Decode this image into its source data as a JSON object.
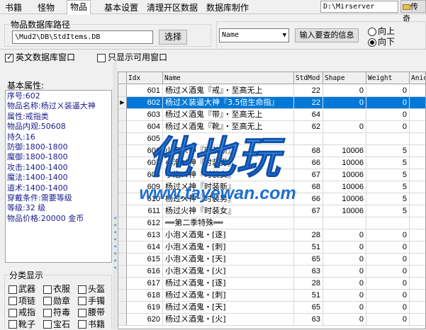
{
  "tabs": [
    "书籍",
    "怪物",
    "物品",
    "基本设置",
    "清理开区数据",
    "数据库制作"
  ],
  "active_tab": "物品",
  "server_path": "D:\\Mirserver",
  "folder_button": "传奇",
  "db_section": {
    "label": "物品数据库路径",
    "path_value": "\\Mud2\\DB\\StdItems.DB",
    "select_button": "选择"
  },
  "search": {
    "field_value": "Name",
    "input_button": "输入要查的信息",
    "dir_up": "向上",
    "dir_down": "向下"
  },
  "options": {
    "english_db_window": "英文数据库窗口",
    "english_db_checked": true,
    "only_usable_window": "只显示可用窗口",
    "only_usable_checked": false
  },
  "basic_info": {
    "label": "基本属性:",
    "lines": [
      "序号:602",
      "物品名称:杨过ㄨ装逼大神",
      "属性:戒指类",
      "物品内观:50608",
      "持久:16",
      "防御:1800-1800",
      "魔御:1800-1800",
      "攻击:1400-1400",
      "魔法:1400-1400",
      "道术:1400-1400",
      "穿戴条件:需要等级",
      "等级:32 级",
      "物品价格:20000 金币"
    ]
  },
  "category": {
    "label": "分类显示",
    "items": [
      "武器",
      "衣服",
      "头盔",
      "项链",
      "勋章",
      "手镯",
      "戒指",
      "符毒",
      "腰带",
      "靴子",
      "宝石",
      "书籍"
    ]
  },
  "grid": {
    "columns": [
      "Idx",
      "Name",
      "StdMod",
      "Shape",
      "Weight",
      "Anic"
    ],
    "selected_index": 1,
    "rows": [
      {
        "idx": "601",
        "name": "杨过ㄨ酒鬼『戒』・至高无上",
        "stdmod": "22",
        "shape": "0",
        "weight": "0"
      },
      {
        "idx": "602",
        "name": "杨过ㄨ装逼大神『3.5倍生命指』",
        "stdmod": "22",
        "shape": "0",
        "weight": "0"
      },
      {
        "idx": "603",
        "name": "杨过ㄨ酒鬼『带』・至高无上",
        "stdmod": "64",
        "shape": "",
        "weight": "0"
      },
      {
        "idx": "604",
        "name": "杨过ㄨ酒鬼『靴』・至高无上",
        "stdmod": "62",
        "shape": "0",
        "weight": "0"
      },
      {
        "idx": "605",
        "name": "",
        "stdmod": "",
        "shape": "",
        "weight": ""
      },
      {
        "idx": "606",
        "name": "小泡ㄨ神『时装新』",
        "stdmod": "68",
        "shape": "10006",
        "weight": "5"
      },
      {
        "idx": "607",
        "name": "小泡ㄨ神『时装男』",
        "stdmod": "66",
        "shape": "10006",
        "weight": "5"
      },
      {
        "idx": "608",
        "name": "小泡ㄨ神『时装女』",
        "stdmod": "67",
        "shape": "10006",
        "weight": "5"
      },
      {
        "idx": "609",
        "name": "杨过ㄨ神『时装新』",
        "stdmod": "68",
        "shape": "10006",
        "weight": "5"
      },
      {
        "idx": "610",
        "name": "杨过ㄨ神『时装男』",
        "stdmod": "66",
        "shape": "10006",
        "weight": "5"
      },
      {
        "idx": "611",
        "name": "杨过火神『时装女』",
        "stdmod": "67",
        "shape": "10006",
        "weight": "5"
      },
      {
        "idx": "612",
        "name": "══第二季特殊══",
        "stdmod": "",
        "shape": "",
        "weight": ""
      },
      {
        "idx": "613",
        "name": "小泡ㄨ酒鬼・[逐]",
        "stdmod": "28",
        "shape": "0",
        "weight": "0"
      },
      {
        "idx": "614",
        "name": "小泡ㄨ酒鬼・[刺]",
        "stdmod": "51",
        "shape": "0",
        "weight": "0"
      },
      {
        "idx": "615",
        "name": "小泡ㄨ酒鬼・[天]",
        "stdmod": "65",
        "shape": "0",
        "weight": "0"
      },
      {
        "idx": "616",
        "name": "小泡ㄨ酒鬼・[火]",
        "stdmod": "63",
        "shape": "0",
        "weight": "0"
      },
      {
        "idx": "617",
        "name": "杨过ㄨ酒鬼・[逐]",
        "stdmod": "28",
        "shape": "0",
        "weight": "0"
      },
      {
        "idx": "618",
        "name": "杨过ㄨ酒鬼・[刺]",
        "stdmod": "51",
        "shape": "0",
        "weight": "0"
      },
      {
        "idx": "619",
        "name": "杨过ㄨ酒鬼・[天]",
        "stdmod": "65",
        "shape": "0",
        "weight": "0"
      },
      {
        "idx": "620",
        "name": "杨过ㄨ酒鬼・[火]",
        "stdmod": "63",
        "shape": "0",
        "weight": "0"
      }
    ]
  },
  "watermark": {
    "logo_text": "他也玩",
    "url_text": "www.tayewan.com"
  },
  "colors": {
    "selection": "#0078d7",
    "info_text": "#1a1a8c",
    "watermark": "#1e6fd0"
  },
  "icons": {
    "folder": "folder-icon",
    "row_indicator": "row-pointer-icon"
  }
}
